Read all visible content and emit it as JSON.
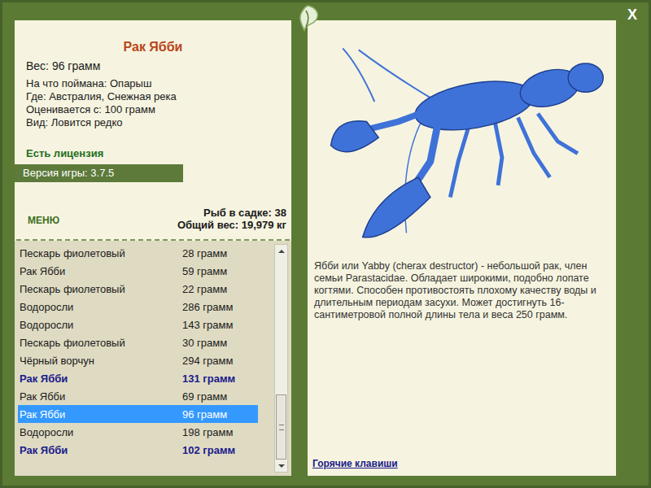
{
  "window": {
    "close": "X"
  },
  "catch": {
    "title": "Рак Ябби",
    "weight": "Вес: 96 грамм",
    "details": [
      "На что поймана: Опарыш",
      "Где: Австралия, Снежная река",
      "Оценивается с: 100 грамм",
      "Вид: Ловится редко"
    ],
    "license": "Есть лицензия"
  },
  "version": "Версия игры: 3.7.5",
  "menu": "МЕНЮ",
  "stats": [
    "Рыб в садке: 38",
    "Общий вес: 19,979 кг"
  ],
  "list": {
    "rows": [
      {
        "name": "Пескарь фиолетовый",
        "weight": "28 грамм",
        "highlighted": false,
        "selected": false
      },
      {
        "name": "Рак Ябби",
        "weight": "59 грамм",
        "highlighted": false,
        "selected": false
      },
      {
        "name": "Пескарь фиолетовый",
        "weight": "22 грамм",
        "highlighted": false,
        "selected": false
      },
      {
        "name": "Водоросли",
        "weight": "286 грамм",
        "highlighted": false,
        "selected": false
      },
      {
        "name": "Водоросли",
        "weight": "143 грамм",
        "highlighted": false,
        "selected": false
      },
      {
        "name": "Пескарь фиолетовый",
        "weight": "30 грамм",
        "highlighted": false,
        "selected": false
      },
      {
        "name": "Чёрный ворчун",
        "weight": "294 грамм",
        "highlighted": false,
        "selected": false
      },
      {
        "name": "Рак Ябби",
        "weight": "131 грамм",
        "highlighted": true,
        "selected": false
      },
      {
        "name": "Рак Ябби",
        "weight": "69 грамм",
        "highlighted": false,
        "selected": false
      },
      {
        "name": "Рак Ябби",
        "weight": "96 грамм",
        "highlighted": false,
        "selected": true
      },
      {
        "name": "Водоросли",
        "weight": "198 грамм",
        "highlighted": false,
        "selected": false
      },
      {
        "name": "Рак Ябби",
        "weight": "102 грамм",
        "highlighted": true,
        "selected": false
      }
    ],
    "scrollbar": {
      "thumb_size": 0.32,
      "position": 1
    }
  },
  "description": "Ябби или Yabby (cherax destructor) - небольшой рак, член семьи Parastacidae. Обладает широкими, подобно лопате когтями. Способен противостоять плохому качеству воды и длительным периодам засухи. Может достигнуть 16-сантиметровой полной длины тела и веса 250 грамм.",
  "hotkeys": "Горячие клавиши"
}
